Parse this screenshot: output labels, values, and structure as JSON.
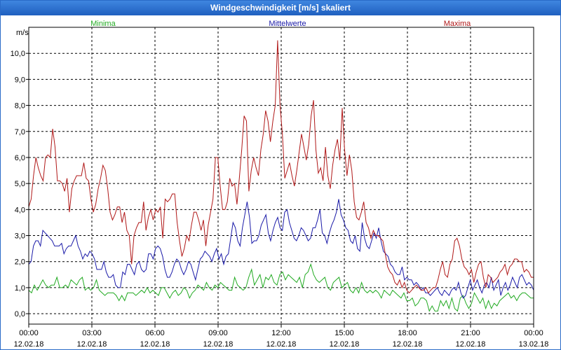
{
  "window": {
    "title": "Windgeschwindigkeit [m/s] skaliert"
  },
  "chart_data": {
    "type": "line",
    "title": "Windgeschwindigkeit [m/s] skaliert",
    "ylabel": "m/s",
    "xlabel": "",
    "ylim": [
      -0.4,
      11.0
    ],
    "xlim": [
      0,
      24
    ],
    "yticks": [
      "0,0",
      "1,0",
      "2,0",
      "3,0",
      "4,0",
      "5,0",
      "6,0",
      "7,0",
      "8,0",
      "9,0",
      "10,0"
    ],
    "xticks": [
      {
        "time": "00:00",
        "date": "12.02.18"
      },
      {
        "time": "03:00",
        "date": "12.02.18"
      },
      {
        "time": "06:00",
        "date": "12.02.18"
      },
      {
        "time": "09:00",
        "date": "12.02.18"
      },
      {
        "time": "12:00",
        "date": "12.02.18"
      },
      {
        "time": "15:00",
        "date": "12.02.18"
      },
      {
        "time": "18:00",
        "date": "12.02.18"
      },
      {
        "time": "21:00",
        "date": "12.02.18"
      },
      {
        "time": "00:00",
        "date": "13.02.18"
      }
    ],
    "grid": true,
    "legend_position": "top",
    "series": [
      {
        "name": "Minima",
        "color": "#22aa22",
        "values": [
          0.9,
          0.8,
          1.1,
          0.9,
          1.1,
          1.3,
          1.1,
          1.0,
          1.1,
          1.1,
          1.4,
          1.0,
          1.0,
          1.1,
          1.0,
          1.3,
          1.2,
          1.1,
          1.3,
          1.4,
          0.9,
          1.0,
          0.9,
          1.0,
          1.3,
          0.9,
          0.8,
          0.7,
          0.8,
          0.8,
          0.8,
          0.7,
          0.5,
          0.7,
          0.5,
          0.8,
          0.8,
          0.8,
          0.7,
          0.8,
          0.9,
          0.8,
          1.0,
          0.8,
          0.9,
          0.8,
          0.7,
          1.0,
          1.0,
          0.8,
          0.6,
          0.8,
          0.9,
          0.7,
          0.8,
          1.0,
          0.9,
          0.6,
          0.8,
          0.9,
          1.1,
          1.0,
          0.9,
          1.2,
          1.0,
          0.9,
          1.1,
          1.0,
          1.2,
          1.1,
          1.0,
          0.9,
          0.9,
          1.4,
          1.1,
          1.0,
          0.9,
          1.0,
          1.4,
          1.7,
          1.1,
          1.3,
          1.5,
          1.0,
          1.4,
          1.3,
          1.5,
          1.2,
          1.1,
          1.5,
          1.6,
          1.3,
          1.5,
          1.4,
          1.3,
          1.2,
          1.4,
          1.0,
          1.5,
          1.6,
          1.9,
          1.5,
          1.3,
          1.2,
          1.3,
          1.4,
          1.0,
          0.9,
          1.2,
          1.3,
          1.4,
          1.0,
          1.1,
          1.2,
          0.9,
          0.8,
          1.0,
          0.8,
          1.2,
          0.9,
          0.8,
          0.9,
          0.8,
          0.9,
          0.8,
          0.6,
          0.9,
          0.8,
          0.7,
          0.9,
          0.8,
          0.7,
          0.6,
          0.8,
          0.5,
          0.5,
          0.6,
          0.3,
          0.4,
          0.6,
          0.6,
          0.5,
          0.1,
          0.3,
          0.1,
          0.1,
          0.5,
          0.3,
          0.5,
          0.2,
          0.6,
          0.2,
          0.1,
          0.6,
          0.7,
          0.4,
          0.2,
          0.4,
          0.8,
          0.6,
          0.4,
          0.6,
          0.2,
          0.5,
          0.2,
          0.4,
          0.3,
          0.5,
          0.6,
          0.7,
          0.8,
          0.6,
          0.7,
          0.5,
          0.7,
          0.8,
          0.8,
          0.7,
          0.6,
          0.6
        ]
      },
      {
        "name": "Mittelwerte",
        "color": "#1a1aa8",
        "values": [
          1.9,
          2.0,
          2.6,
          2.8,
          2.8,
          2.6,
          3.2,
          3.1,
          3.0,
          2.9,
          2.8,
          2.6,
          2.6,
          2.6,
          2.7,
          2.3,
          2.5,
          2.6,
          2.6,
          2.8,
          3.0,
          2.6,
          2.4,
          2.1,
          2.3,
          2.2,
          2.4,
          2.3,
          2.1,
          1.7,
          1.7,
          1.7,
          2.0,
          1.6,
          1.4,
          1.4,
          1.5,
          1.1,
          1.0,
          1.0,
          1.6,
          1.5,
          1.9,
          1.9,
          1.7,
          1.5,
          1.9,
          2.0,
          1.7,
          1.6,
          1.7,
          2.3,
          2.3,
          2.1,
          2.5,
          2.6,
          2.5,
          2.2,
          1.7,
          1.4,
          1.4,
          1.6,
          1.9,
          2.1,
          2.0,
          1.7,
          1.5,
          1.7,
          2.0,
          1.9,
          1.6,
          1.3,
          1.7,
          2.1,
          2.2,
          2.4,
          2.3,
          2.2,
          2.0,
          2.3,
          2.5,
          2.1,
          2.3,
          1.9,
          2.2,
          2.3,
          2.9,
          3.5,
          3.3,
          2.8,
          2.6,
          3.3,
          3.8,
          4.3,
          3.7,
          2.7,
          2.8,
          2.8,
          3.0,
          3.4,
          3.6,
          3.8,
          3.1,
          2.8,
          3.2,
          3.5,
          3.7,
          3.3,
          3.2,
          3.9,
          4.0,
          3.5,
          3.2,
          2.9,
          2.8,
          3.0,
          3.3,
          3.2,
          3.0,
          2.8,
          2.9,
          3.3,
          3.3,
          3.6,
          4.0,
          3.1,
          3.0,
          2.7,
          3.1,
          3.4,
          3.6,
          3.9,
          4.4,
          3.8,
          3.6,
          3.3,
          3.2,
          2.8,
          2.7,
          3.0,
          2.5,
          2.4,
          3.5,
          2.9,
          2.6,
          2.5,
          2.8,
          3.1,
          2.9,
          3.3,
          2.8,
          2.4,
          2.3,
          2.2,
          1.9,
          1.8,
          1.6,
          1.5,
          1.5,
          1.8,
          1.3,
          1.4,
          1.3,
          1.3,
          1.1,
          1.2,
          1.1,
          0.9,
          1.0,
          0.8,
          0.8,
          0.7,
          0.8,
          0.9,
          1.0,
          0.8,
          0.7,
          0.9,
          0.8,
          0.7,
          0.9,
          1.0,
          0.9,
          1.2,
          0.8,
          0.6,
          0.7,
          1.0,
          1.3,
          0.9,
          1.1,
          1.3,
          1.0,
          0.8,
          1.1,
          1.2,
          1.0,
          1.4,
          0.9,
          1.1,
          1.3,
          0.7,
          1.0,
          1.2,
          0.9,
          1.1,
          1.4,
          1.2,
          1.0,
          1.4,
          1.5,
          1.3,
          1.1,
          1.2,
          1.1,
          0.9
        ]
      },
      {
        "name": "Maxima",
        "color": "#b01818",
        "values": [
          4.1,
          4.4,
          5.3,
          6.0,
          5.6,
          5.3,
          5.1,
          6.0,
          6.1,
          6.0,
          7.1,
          6.4,
          5.1,
          5.1,
          5.0,
          4.7,
          5.2,
          3.9,
          4.8,
          5.1,
          5.3,
          5.3,
          5.3,
          5.8,
          5.2,
          5.1,
          4.4,
          3.9,
          4.2,
          4.8,
          5.2,
          5.7,
          5.5,
          4.8,
          3.9,
          3.6,
          3.8,
          4.1,
          4.1,
          3.5,
          3.9,
          3.2,
          3.0,
          1.9,
          3.0,
          3.3,
          3.5,
          3.5,
          4.3,
          3.2,
          3.7,
          4.0,
          3.6,
          4.0,
          3.9,
          4.1,
          2.9,
          4.4,
          4.3,
          4.4,
          4.6,
          4.6,
          3.5,
          2.8,
          2.2,
          2.5,
          3.0,
          2.8,
          3.4,
          3.9,
          3.9,
          3.6,
          3.2,
          3.6,
          2.6,
          3.4,
          3.9,
          4.4,
          6.0,
          6.0,
          4.9,
          4.0,
          4.0,
          4.3,
          5.2,
          4.9,
          5.0,
          4.2,
          5.2,
          6.3,
          7.6,
          7.4,
          4.7,
          5.5,
          6.0,
          5.6,
          5.3,
          6.3,
          6.9,
          7.8,
          7.4,
          6.6,
          7.4,
          8.0,
          10.5,
          8.0,
          6.9,
          5.2,
          5.5,
          5.8,
          5.3,
          4.9,
          5.5,
          6.2,
          6.9,
          6.4,
          5.9,
          6.5,
          7.6,
          8.2,
          6.3,
          5.4,
          5.6,
          5.1,
          6.4,
          5.3,
          4.8,
          5.7,
          6.3,
          6.7,
          5.9,
          7.9,
          6.3,
          5.3,
          6.1,
          5.5,
          4.3,
          3.7,
          3.6,
          3.9,
          4.3,
          3.5,
          3.3,
          2.9,
          3.2,
          3.0,
          3.0,
          2.9,
          2.8,
          2.3,
          1.8,
          1.6,
          1.5,
          1.2,
          1.1,
          1.3,
          1.0,
          1.2,
          0.9,
          0.8,
          0.9,
          1.0,
          1.1,
          1.0,
          0.9,
          0.9,
          1.0,
          0.8,
          0.9,
          1.0,
          1.0,
          1.3,
          1.7,
          2.0,
          1.5,
          1.4,
          1.9,
          2.1,
          2.8,
          2.9,
          2.6,
          2.1,
          1.8,
          1.7,
          1.5,
          1.7,
          1.2,
          1.6,
          1.9,
          2.0,
          1.4,
          1.0,
          1.5,
          1.4,
          1.2,
          1.3,
          1.4,
          1.6,
          1.7,
          1.9,
          1.5,
          1.8,
          1.9,
          2.1,
          2.1,
          2.0,
          2.0,
          1.6,
          1.7,
          1.6,
          1.4,
          1.4
        ]
      }
    ]
  }
}
